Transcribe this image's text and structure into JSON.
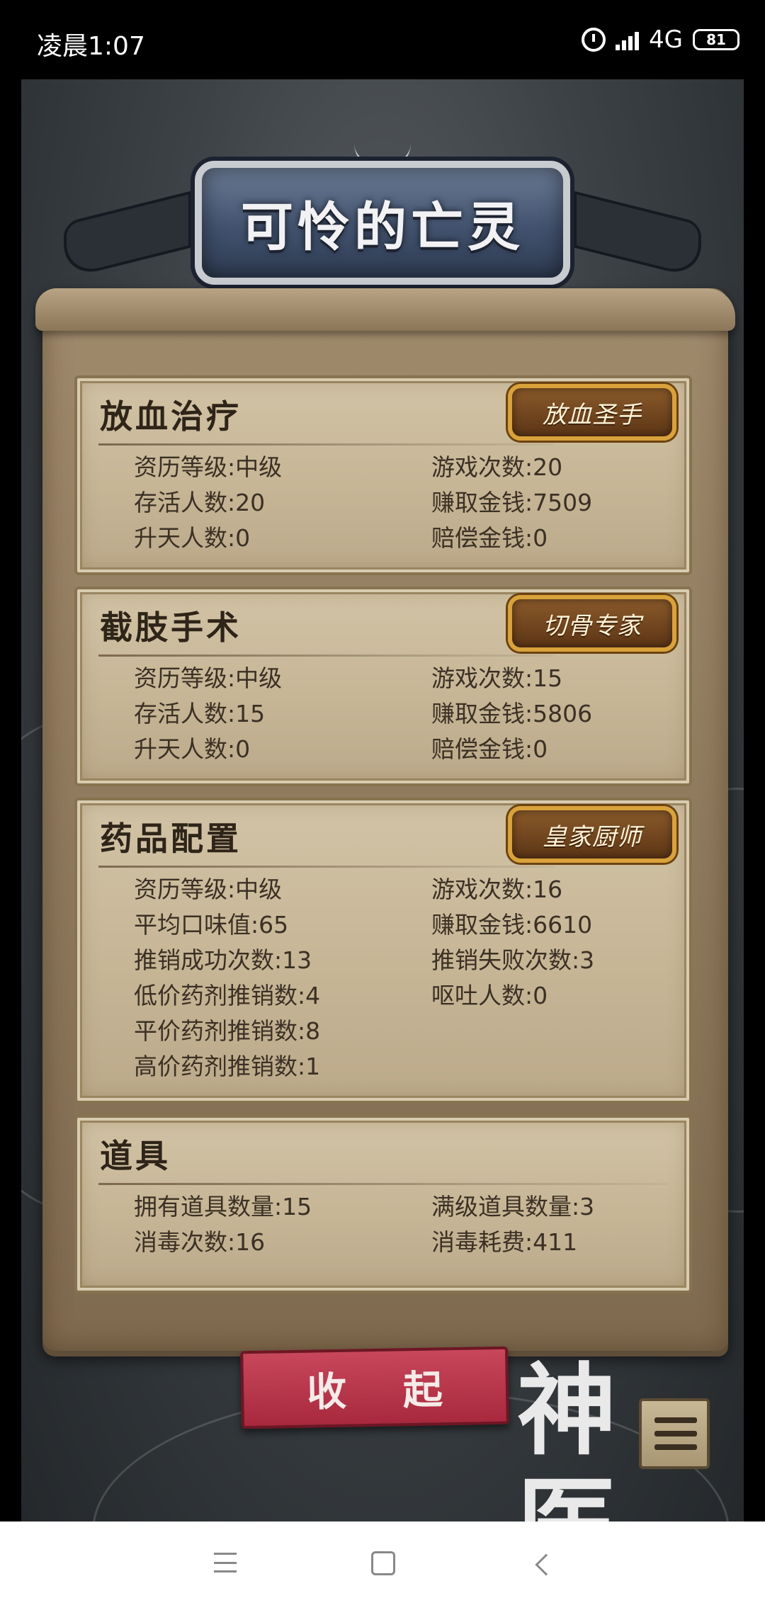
{
  "status_bar": {
    "time": "凌晨1:07",
    "network": "4G",
    "battery": "81"
  },
  "title": "可怜的亡灵",
  "cards": [
    {
      "title": "放血治疗",
      "badge": "放血圣手",
      "stats": [
        "资历等级:中级",
        "游戏次数:20",
        "存活人数:20",
        "赚取金钱:7509",
        "升天人数:0",
        "赔偿金钱:0"
      ]
    },
    {
      "title": "截肢手术",
      "badge": "切骨专家",
      "stats": [
        "资历等级:中级",
        "游戏次数:15",
        "存活人数:15",
        "赚取金钱:5806",
        "升天人数:0",
        "赔偿金钱:0"
      ]
    },
    {
      "title": "药品配置",
      "badge": "皇家厨师",
      "stats": [
        "资历等级:中级",
        "游戏次数:16",
        "平均口味值:65",
        "赚取金钱:6610",
        "推销成功次数:13",
        "推销失败次数:3",
        "低价药剂推销数:4",
        "呕吐人数:0",
        "平价药剂推销数:8",
        "",
        "高价药剂推销数:1",
        ""
      ]
    },
    {
      "title": "道具",
      "stats": [
        "拥有道具数量:15",
        "满级道具数量:3",
        "消毒次数:16",
        "消毒耗费:411"
      ]
    }
  ],
  "collapse_button": "收 起",
  "logo_text": "神医",
  "colors": {
    "banner_blue": "#42526e",
    "parchment": "#c6b696",
    "button_red": "#b3334a",
    "badge_gold": "#d9a23a"
  }
}
